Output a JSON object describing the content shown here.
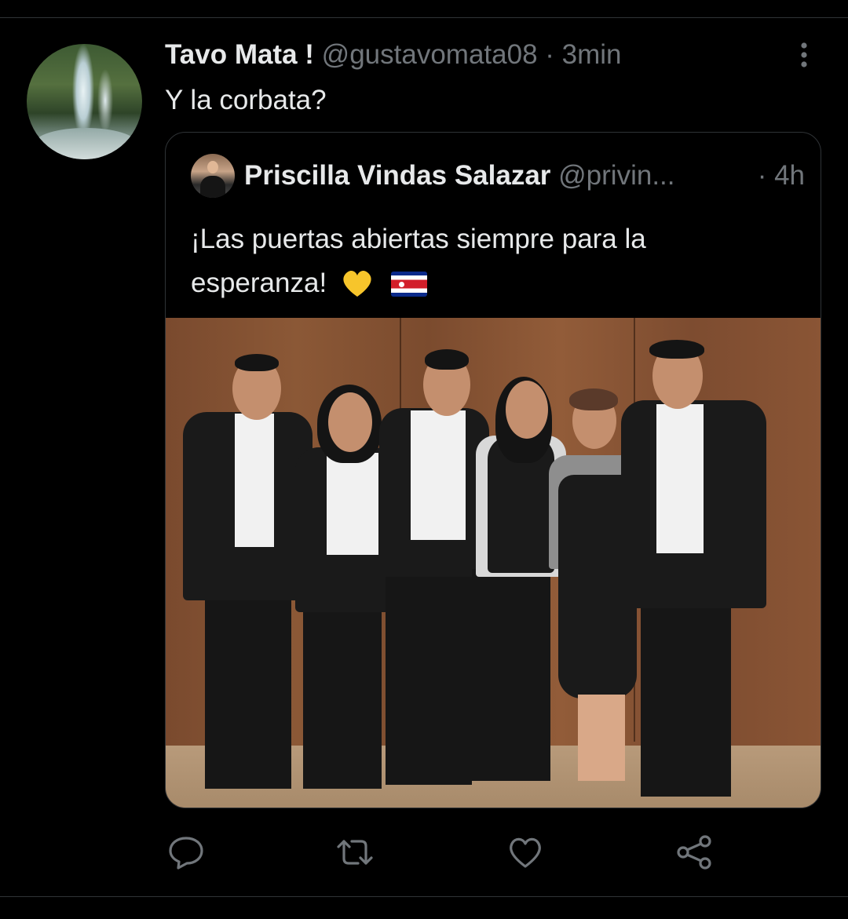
{
  "tweet": {
    "author_name": "Tavo Mata !",
    "author_handle": "@gustavomata08",
    "separator": "·",
    "timestamp": "3min",
    "text": "Y la corbata?",
    "avatar_icon": "waterfall-avatar"
  },
  "quoted_tweet": {
    "author_name": "Priscilla Vindas Salazar",
    "author_handle": "@privin...",
    "timestamp": "· 4h",
    "text_line1": "¡Las puertas abiertas siempre para la",
    "text_line2": "esperanza!",
    "emojis": [
      "yellow-heart",
      "costa-rica-flag"
    ],
    "image_icon": "group-photo"
  },
  "actions": {
    "reply_icon": "reply-icon",
    "retweet_icon": "retweet-icon",
    "like_icon": "heart-icon",
    "share_icon": "share-icon"
  },
  "colors": {
    "background": "#000000",
    "text": "#e7e9ea",
    "muted": "#71767b",
    "border": "#2f3336"
  }
}
